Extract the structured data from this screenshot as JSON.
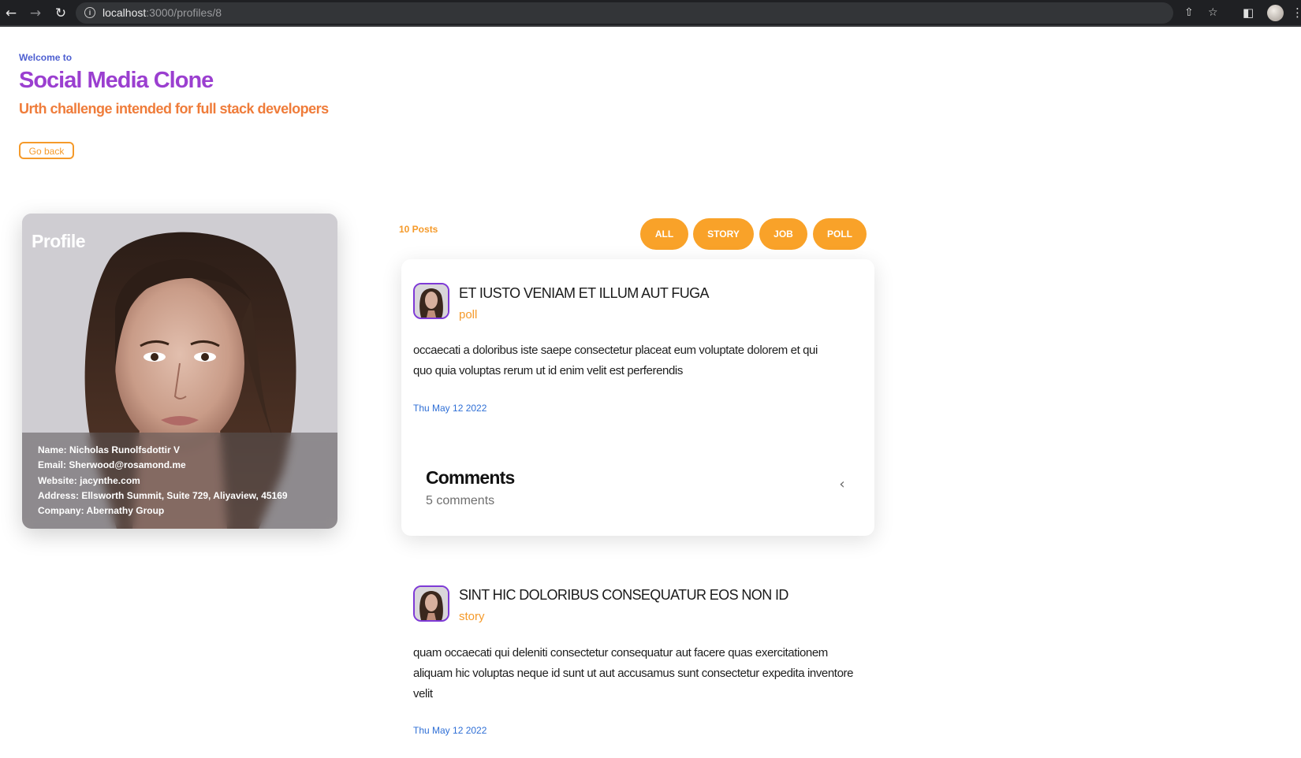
{
  "browser": {
    "url_host": "localhost",
    "url_path": ":3000/profiles/8"
  },
  "header": {
    "welcome": "Welcome to",
    "title": "Social Media Clone",
    "subtitle": "Urth challenge intended for full stack developers",
    "go_back": "Go back"
  },
  "profile": {
    "label": "Profile",
    "name": "Name: Nicholas Runolfsdottir V",
    "email": "Email: Sherwood@rosamond.me",
    "website": "Website: jacynthe.com",
    "address": "Address: Ellsworth Summit, Suite 729, Aliyaview, 45169",
    "company": "Company: Abernathy Group"
  },
  "posts": {
    "count": "10 Posts",
    "filters": [
      "ALL",
      "STORY",
      "JOB",
      "POLL"
    ],
    "filter_color": "#f9a229",
    "items": [
      {
        "title": "ET IUSTO VENIAM ET ILLUM AUT FUGA",
        "type": "poll",
        "body": "occaecati a doloribus iste saepe consectetur placeat eum voluptate dolorem et qui quo quia voluptas rerum ut id enim velit est perferendis",
        "date": "Thu May 12 2022",
        "comments_title": "Comments",
        "comments_count": "5 comments"
      },
      {
        "title": "SINT HIC DOLORIBUS CONSEQUATUR EOS NON ID",
        "type": "story",
        "body": "quam occaecati qui deleniti consectetur consequatur aut facere quas exercitationem aliquam hic voluptas neque id sunt ut aut accusamus sunt consectetur expedita inventore velit",
        "date": "Thu May 12 2022"
      }
    ]
  },
  "colors": {
    "title": "#9b3fd0",
    "subtitle": "#ef7c3a",
    "accent": "#f59a2a",
    "link": "#2f6fd6"
  }
}
